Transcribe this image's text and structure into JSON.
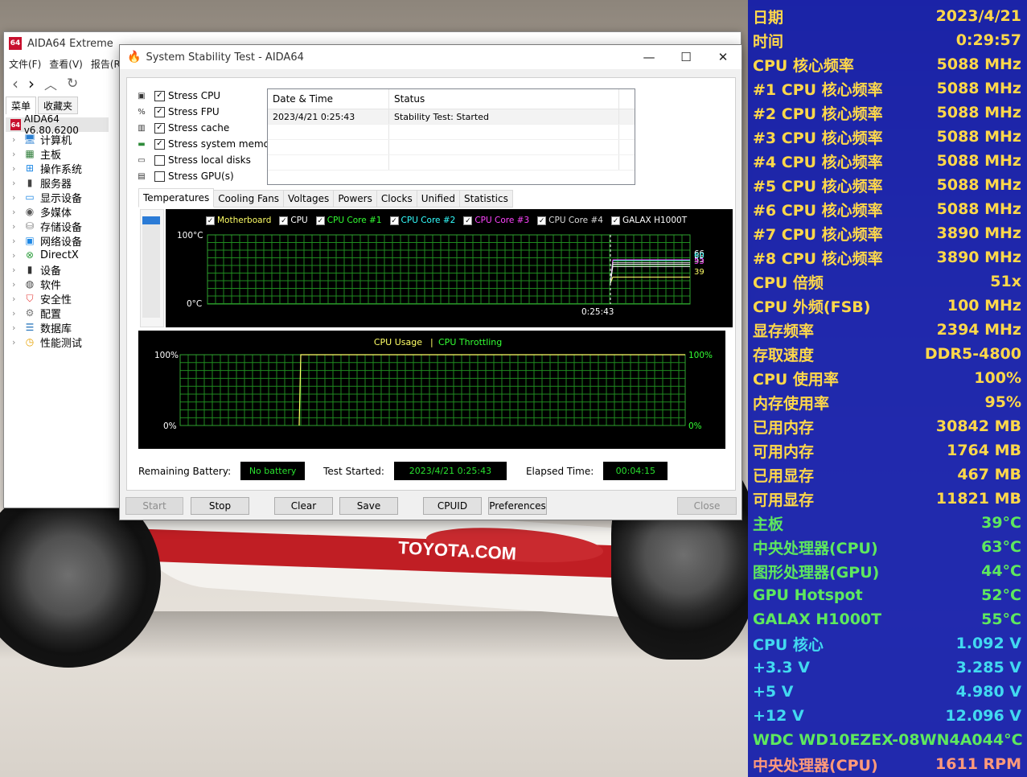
{
  "main_window": {
    "logo": "64",
    "title": "AIDA64 Extreme",
    "menu": [
      "文件(F)",
      "查看(V)",
      "报告(R"
    ],
    "tree_tabs": [
      "菜单",
      "收藏夹"
    ],
    "root": "AIDA64 v6.80.6200",
    "tree_items": [
      {
        "label": "计算机",
        "icon": "computer-icon"
      },
      {
        "label": "主板",
        "icon": "motherboard-icon"
      },
      {
        "label": "操作系统",
        "icon": "windows-icon"
      },
      {
        "label": "服务器",
        "icon": "server-icon"
      },
      {
        "label": "显示设备",
        "icon": "display-icon"
      },
      {
        "label": "多媒体",
        "icon": "speaker-icon"
      },
      {
        "label": "存储设备",
        "icon": "storage-icon"
      },
      {
        "label": "网络设备",
        "icon": "network-icon"
      },
      {
        "label": "DirectX",
        "icon": "xbox-icon"
      },
      {
        "label": "设备",
        "icon": "device-icon"
      },
      {
        "label": "软件",
        "icon": "software-icon"
      },
      {
        "label": "安全性",
        "icon": "shield-icon"
      },
      {
        "label": "配置",
        "icon": "config-icon"
      },
      {
        "label": "数据库",
        "icon": "database-icon"
      },
      {
        "label": "性能测试",
        "icon": "benchmark-icon"
      }
    ]
  },
  "dialog": {
    "title": "System Stability Test - AIDA64",
    "stress": [
      {
        "label": "Stress CPU",
        "checked": true,
        "icon": "cpu-chip-icon"
      },
      {
        "label": "Stress FPU",
        "checked": true,
        "icon": "fpu-icon"
      },
      {
        "label": "Stress cache",
        "checked": true,
        "icon": "cache-icon"
      },
      {
        "label": "Stress system memory",
        "checked": true,
        "icon": "memory-icon"
      },
      {
        "label": "Stress local disks",
        "checked": false,
        "icon": "disk-icon"
      },
      {
        "label": "Stress GPU(s)",
        "checked": false,
        "icon": "gpu-icon"
      }
    ],
    "log": {
      "headers": [
        "Date & Time",
        "Status"
      ],
      "rows": [
        [
          "2023/4/21 0:25:43",
          "Stability Test: Started"
        ]
      ]
    },
    "tabs": [
      "Temperatures",
      "Cooling Fans",
      "Voltages",
      "Powers",
      "Clocks",
      "Unified",
      "Statistics"
    ],
    "temp_graph": {
      "legend": [
        {
          "label": "Motherboard",
          "color": "#ffff66"
        },
        {
          "label": "CPU",
          "color": "#ffffff"
        },
        {
          "label": "CPU Core #1",
          "color": "#33ff33"
        },
        {
          "label": "CPU Core #2",
          "color": "#33ffff"
        },
        {
          "label": "CPU Core #3",
          "color": "#ff44ff"
        },
        {
          "label": "CPU Core #4",
          "color": "#dddddd"
        },
        {
          "label": "GALAX H1000T",
          "color": "#ffffff"
        }
      ],
      "y_max": "100°C",
      "y_min": "0°C",
      "x_marker": "0:25:43",
      "end_labels": [
        {
          "text": "66",
          "color": "#ffffff"
        },
        {
          "text": "60",
          "color": "#33ffff"
        },
        {
          "text": "55",
          "color": "#ffffff"
        },
        {
          "text": "53",
          "color": "#ff44ff"
        },
        {
          "text": "39",
          "color": "#ffff66"
        }
      ]
    },
    "usage_graph": {
      "legend_a": "CPU Usage",
      "separator": "|",
      "legend_b": "CPU Throttling",
      "legend_a_color": "#ffff66",
      "legend_b_color": "#33ff33",
      "left_top": "100%",
      "left_bottom": "0%",
      "right_top": "100%",
      "right_bottom": "0%"
    },
    "status": {
      "battery_label": "Remaining Battery:",
      "battery_value": "No battery",
      "started_label": "Test Started:",
      "started_value": "2023/4/21 0:25:43",
      "elapsed_label": "Elapsed Time:",
      "elapsed_value": "00:04:15"
    },
    "buttons": {
      "start": "Start",
      "stop": "Stop",
      "clear": "Clear",
      "save": "Save",
      "cpuid": "CPUID",
      "preferences": "Preferences",
      "close": "Close"
    }
  },
  "wallpaper": {
    "brand_text": "TOYOTA.COM"
  },
  "osd": [
    {
      "label": "日期",
      "value": "2023/4/21",
      "color": "#ffd84a"
    },
    {
      "label": "时间",
      "value": "0:29:57",
      "color": "#ffd84a"
    },
    {
      "label": "CPU 核心频率",
      "value": "5088 MHz",
      "color": "#ffd84a"
    },
    {
      "label": "#1 CPU 核心频率",
      "value": "5088 MHz",
      "color": "#ffd84a"
    },
    {
      "label": "#2 CPU 核心频率",
      "value": "5088 MHz",
      "color": "#ffd84a"
    },
    {
      "label": "#3 CPU 核心频率",
      "value": "5088 MHz",
      "color": "#ffd84a"
    },
    {
      "label": "#4 CPU 核心频率",
      "value": "5088 MHz",
      "color": "#ffd84a"
    },
    {
      "label": "#5 CPU 核心频率",
      "value": "5088 MHz",
      "color": "#ffd84a"
    },
    {
      "label": "#6 CPU 核心频率",
      "value": "5088 MHz",
      "color": "#ffd84a"
    },
    {
      "label": "#7 CPU 核心频率",
      "value": "3890 MHz",
      "color": "#ffd84a"
    },
    {
      "label": "#8 CPU 核心频率",
      "value": "3890 MHz",
      "color": "#ffd84a"
    },
    {
      "label": "CPU 倍频",
      "value": "51x",
      "color": "#ffd84a"
    },
    {
      "label": "CPU 外频(FSB)",
      "value": "100 MHz",
      "color": "#ffd84a"
    },
    {
      "label": "显存频率",
      "value": "2394 MHz",
      "color": "#ffd84a"
    },
    {
      "label": "存取速度",
      "value": "DDR5-4800",
      "color": "#ffd84a"
    },
    {
      "label": "CPU 使用率",
      "value": "100%",
      "color": "#ffd84a"
    },
    {
      "label": "内存使用率",
      "value": "95%",
      "color": "#ffd84a"
    },
    {
      "label": "已用内存",
      "value": "30842 MB",
      "color": "#ffd84a"
    },
    {
      "label": "可用内存",
      "value": "1764 MB",
      "color": "#ffd84a"
    },
    {
      "label": "已用显存",
      "value": "467 MB",
      "color": "#ffd84a"
    },
    {
      "label": "可用显存",
      "value": "11821 MB",
      "color": "#ffd84a"
    },
    {
      "label": "主板",
      "value": "39°C",
      "color": "#5ee85e"
    },
    {
      "label": "中央处理器(CPU)",
      "value": "63°C",
      "color": "#5ee85e"
    },
    {
      "label": "图形处理器(GPU)",
      "value": "44°C",
      "color": "#5ee85e"
    },
    {
      "label": "GPU Hotspot",
      "value": "52°C",
      "color": "#5ee85e"
    },
    {
      "label": "GALAX H1000T",
      "value": "55°C",
      "color": "#5ee85e"
    },
    {
      "label": "CPU 核心",
      "value": "1.092 V",
      "color": "#42d9f0"
    },
    {
      "label": "+3.3 V",
      "value": "3.285 V",
      "color": "#42d9f0"
    },
    {
      "label": "+5 V",
      "value": "4.980 V",
      "color": "#42d9f0"
    },
    {
      "label": "+12 V",
      "value": "12.096 V",
      "color": "#42d9f0"
    },
    {
      "label": "WDC WD10EZEX-08WN4A0",
      "value": "44°C",
      "color": "#5ee85e"
    },
    {
      "label": "中央处理器(CPU)",
      "value": "1611 RPM",
      "color": "#ff9a7a"
    }
  ]
}
